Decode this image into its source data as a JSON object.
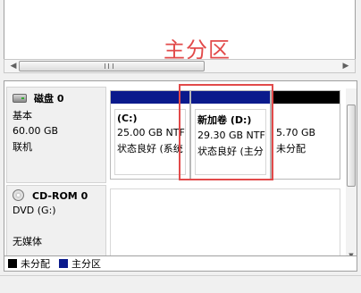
{
  "annotation": {
    "text": "主分区"
  },
  "disks": [
    {
      "name": "磁盘 0",
      "type": "基本",
      "size": "60.00 GB",
      "status": "联机",
      "partitions": [
        {
          "label": "(C:)",
          "size": "25.00 GB NTF",
          "status": "状态良好 (系统"
        },
        {
          "label": "新加卷  (D:)",
          "size": "29.30 GB NTF",
          "status": "状态良好 (主分"
        },
        {
          "label": "",
          "size": "5.70 GB",
          "status": "未分配"
        }
      ]
    },
    {
      "name": "CD-ROM 0",
      "type": "DVD (G:)",
      "status": "无媒体"
    }
  ],
  "legend": [
    {
      "label": "未分配",
      "color": "#000000"
    },
    {
      "label": "主分区",
      "color": "#0a1a8c"
    }
  ],
  "colors": {
    "primary": "#0a1a8c",
    "unallocated": "#000000",
    "highlight": "#e24a4a"
  }
}
